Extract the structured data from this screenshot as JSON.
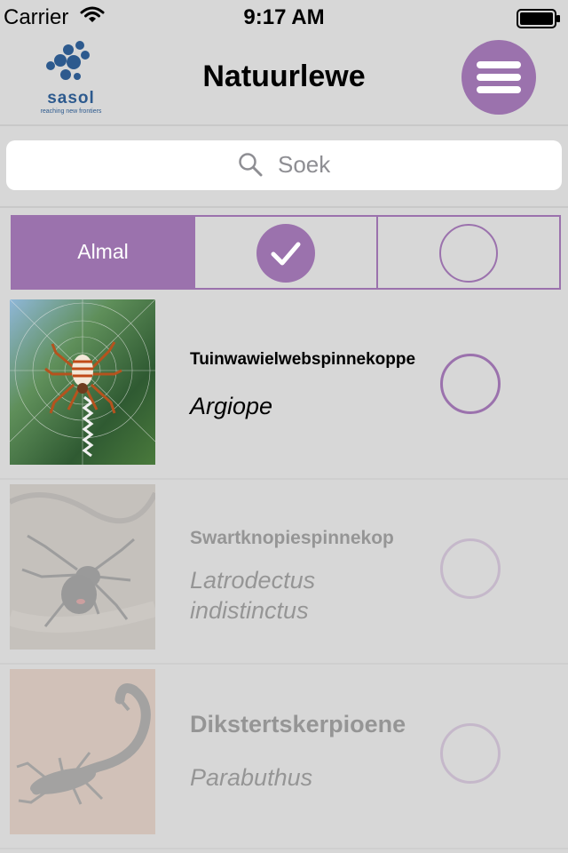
{
  "status": {
    "carrier": "Carrier",
    "time": "9:17 AM"
  },
  "nav": {
    "title": "Natuurlewe",
    "logo": {
      "name": "sasol",
      "tagline": "reaching new frontiers"
    },
    "accent": "#9b72ad"
  },
  "search": {
    "placeholder": "Soek"
  },
  "filter": {
    "segments": [
      {
        "label": "Almal",
        "selected": true
      },
      {
        "icon": "checkmark-icon",
        "selected": false
      },
      {
        "icon": "empty-circle-icon",
        "selected": false
      }
    ]
  },
  "species": [
    {
      "common": "Tuinwawielwebspinnekoppe",
      "scientific": "Argiope",
      "checked": false,
      "dimmed": false
    },
    {
      "common": "Swartknopiespinnekop",
      "scientific": "Latrodectus indistinctus",
      "checked": false,
      "dimmed": true
    },
    {
      "common": "Dikstertskerpioene",
      "scientific": "Parabuthus",
      "checked": false,
      "dimmed": true
    }
  ]
}
